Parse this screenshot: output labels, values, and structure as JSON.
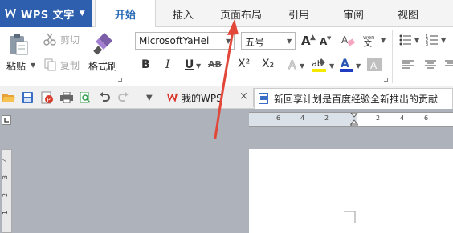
{
  "app": {
    "name": "WPS 文字"
  },
  "tabs": [
    "开始",
    "插入",
    "页面布局",
    "引用",
    "审阅",
    "视图"
  ],
  "ribbon": {
    "paste": "粘贴",
    "cut": "剪切",
    "copy": "复制",
    "format_painter": "格式刷",
    "font_name": "MicrosoftYaHei",
    "font_size": "五号",
    "bold": "B",
    "italic": "I",
    "underline": "U",
    "strikethrough": "AB",
    "superscript": "X²",
    "subscript": "X₂",
    "grow_font": "A",
    "shrink_font": "A",
    "font_color": "A",
    "highlight": "ab"
  },
  "doc_tabs": [
    {
      "title": "我的WPS",
      "close": "×"
    },
    {
      "title": "新回享计划是百度经验全新推出的贡献"
    }
  ],
  "ruler": {
    "h_labels": [
      "6",
      "4",
      "2",
      "2",
      "4",
      "6"
    ],
    "v_labels": [
      "4",
      "3",
      "2",
      "1"
    ]
  },
  "colors": {
    "brand": "#2d5fae",
    "active_tab_text": "#2a6bb6",
    "arrow": "#e2483a",
    "canvas": "#aeb3bb"
  }
}
